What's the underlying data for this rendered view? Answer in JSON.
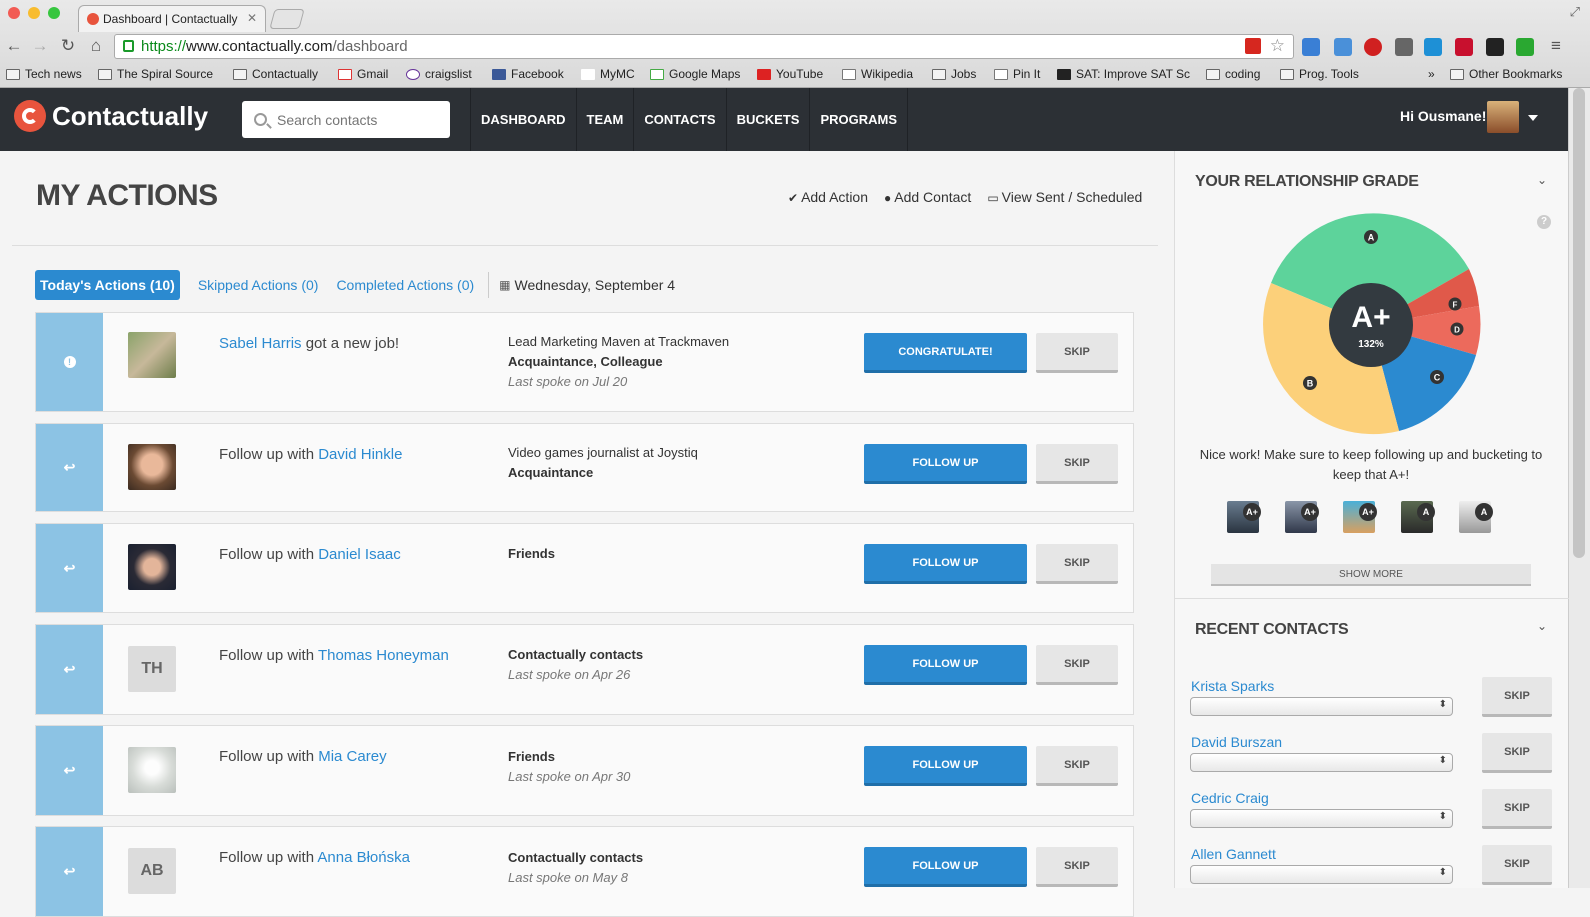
{
  "browser": {
    "tab_title": "Dashboard | Contactually",
    "url_proto": "https://",
    "url_host": "www.contactually.com",
    "url_path": "/dashboard",
    "bookmarks": [
      "Tech news",
      "The Spiral Source",
      "Contactually",
      "Gmail",
      "craigslist",
      "Facebook",
      "MyMC",
      "Google Maps",
      "YouTube",
      "Wikipedia",
      "Jobs",
      "Pin It",
      "SAT: Improve SAT Sc",
      "coding",
      "Prog. Tools"
    ],
    "bookmarks_more": "»",
    "other_bookmarks": "Other Bookmarks"
  },
  "app": {
    "logo": "Contactually",
    "search_placeholder": "Search contacts",
    "nav": [
      "DASHBOARD",
      "TEAM",
      "CONTACTS",
      "BUCKETS",
      "PROGRAMS"
    ],
    "greeting": "Hi Ousmane!"
  },
  "main": {
    "title": "MY ACTIONS",
    "actions": [
      "Add Action",
      "Add Contact",
      "View Sent / Scheduled"
    ],
    "tabs": {
      "today": "Today's Actions (10)",
      "skipped": "Skipped Actions (0)",
      "completed": "Completed Actions (0)",
      "date": "Wednesday, September 4"
    },
    "cards": [
      {
        "icon": "!",
        "prefix": "",
        "name": "Sabel Harris",
        "suffix": " got a new job!",
        "line1": "Lead Marketing Maven at Trackmaven",
        "line2": "Acquaintance, Colleague",
        "line3": "Last spoke on Jul 20",
        "button": "CONGRATULATE!",
        "skip": "SKIP"
      },
      {
        "icon": "↩",
        "prefix": "Follow up with ",
        "name": "David Hinkle",
        "suffix": "",
        "line1": "Video games journalist at Joystiq",
        "line2": "Acquaintance",
        "line3": "",
        "button": "FOLLOW UP",
        "skip": "SKIP"
      },
      {
        "icon": "↩",
        "prefix": "Follow up with ",
        "name": "Daniel Isaac",
        "suffix": "",
        "line1": "",
        "line2": "Friends",
        "line3": "",
        "button": "FOLLOW UP",
        "skip": "SKIP"
      },
      {
        "icon": "↩",
        "prefix": "Follow up with ",
        "name": "Thomas Honeyman",
        "suffix": "",
        "initials": "TH",
        "line1": "",
        "line2": "Contactually contacts",
        "line3": "Last spoke on Apr 26",
        "button": "FOLLOW UP",
        "skip": "SKIP"
      },
      {
        "icon": "↩",
        "prefix": "Follow up with ",
        "name": "Mia Carey",
        "suffix": "",
        "line1": "",
        "line2": "Friends",
        "line3": "Last spoke on Apr 30",
        "button": "FOLLOW UP",
        "skip": "SKIP"
      },
      {
        "icon": "↩",
        "prefix": "Follow up with ",
        "name": "Anna Błońska",
        "suffix": "",
        "initials": "AB",
        "line1": "",
        "line2": "Contactually contacts",
        "line3": "Last spoke on May 8",
        "button": "FOLLOW UP",
        "skip": "SKIP"
      }
    ]
  },
  "sidebar": {
    "grade_title": "YOUR RELATIONSHIP GRADE",
    "help": "?",
    "grade": "A+",
    "grade_pct": "132%",
    "grade_segments": [
      {
        "label": "A",
        "color": "#5dd39b"
      },
      {
        "label": "F",
        "color": "#e0594a"
      },
      {
        "label": "D",
        "color": "#ec6a5c"
      },
      {
        "label": "C",
        "color": "#2b8ad0"
      },
      {
        "label": "B",
        "color": "#fcd07a"
      }
    ],
    "grade_message": "Nice work! Make sure to keep following up and bucketing to keep that A+!",
    "mini_grades": [
      "A+",
      "A+",
      "A+",
      "A",
      "A"
    ],
    "show_more": "SHOW MORE",
    "recent_title": "RECENT CONTACTS",
    "recent": [
      {
        "name": "Krista Sparks",
        "skip": "SKIP"
      },
      {
        "name": "David Burszan",
        "skip": "SKIP"
      },
      {
        "name": "Cedric Craig",
        "skip": "SKIP"
      },
      {
        "name": "Allen Gannett",
        "skip": "SKIP"
      }
    ]
  }
}
